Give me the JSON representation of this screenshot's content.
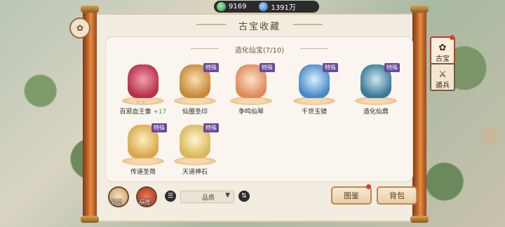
{
  "currency": [
    {
      "icon": "jade-coin-icon",
      "value": "9169"
    },
    {
      "icon": "spirit-stone-icon",
      "value": "1391万"
    }
  ],
  "header": {
    "title": "古宝收藏",
    "subtitle": "造化仙宝(7/10)"
  },
  "items": [
    {
      "name": "百邪血王像",
      "bonus": "+17",
      "stars": "★★",
      "tag": "",
      "color": "#d8506a"
    },
    {
      "name": "仙盟圣印",
      "bonus": "",
      "stars": "",
      "tag": "特殊",
      "color": "#e0b26a"
    },
    {
      "name": "争鸣仙琴",
      "bonus": "",
      "stars": "",
      "tag": "特殊",
      "color": "#e8a070"
    },
    {
      "name": "千世玉镜",
      "bonus": "",
      "stars": "",
      "tag": "特殊",
      "color": "#6ab0e0"
    },
    {
      "name": "造化仙鼎",
      "bonus": "",
      "stars": "",
      "tag": "特殊",
      "color": "#5a9ab8"
    },
    {
      "name": "传道圣简",
      "bonus": "",
      "stars": "",
      "tag": "特殊",
      "color": "#e8c070"
    },
    {
      "name": "天道神石",
      "bonus": "",
      "stars": "",
      "tag": "特殊",
      "color": "#e6d08a"
    }
  ],
  "side_tabs": [
    {
      "label": "古宝",
      "glyph": "✿",
      "active": true
    },
    {
      "label": "遁兵",
      "glyph": "⚔",
      "active": false
    }
  ],
  "bottom": {
    "left_buttons": [
      {
        "label": "总览"
      },
      {
        "label": "福赠"
      }
    ],
    "filter_icon": "filter-icon",
    "select_value": "品质",
    "sort_icon": "sort-icon",
    "catalog_label": "图鉴",
    "bag_label": "背包"
  },
  "colors": {
    "accent_red": "#e33a2a",
    "tag_purple": "#6a4a9c",
    "scroll_wood": "#c66a2c"
  }
}
